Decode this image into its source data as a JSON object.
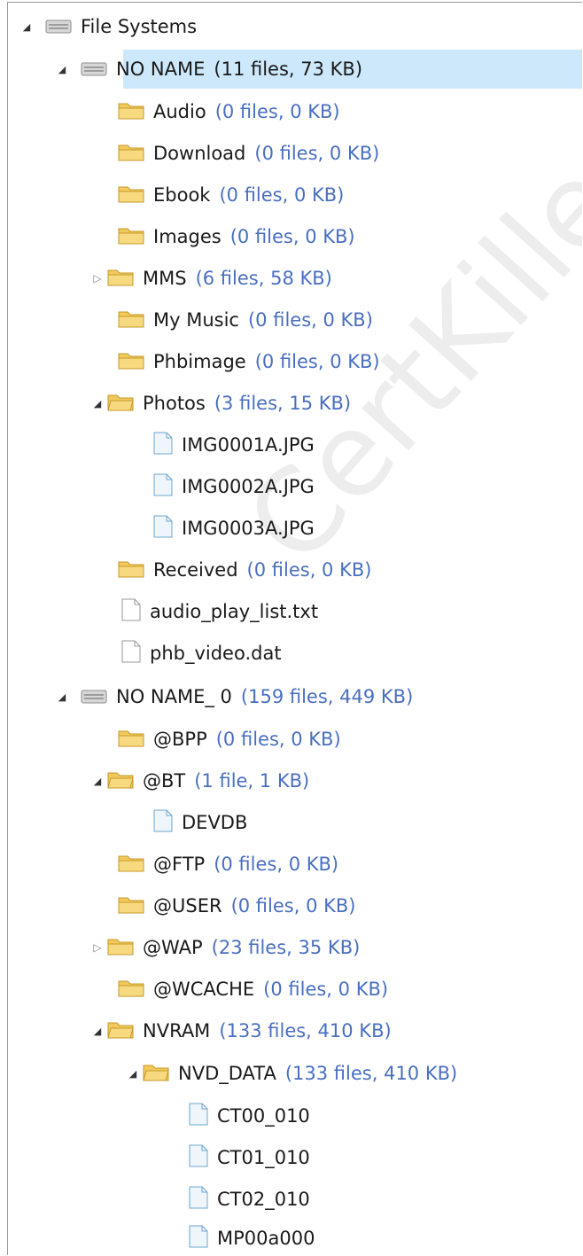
{
  "tree": {
    "root": {
      "label": "File Systems"
    },
    "volumes": [
      {
        "name": "NO NAME",
        "meta": "(11 files, 73 KB)",
        "children": [
          {
            "name": "Audio",
            "meta": "(0 files, 0 KB)"
          },
          {
            "name": "Download",
            "meta": "(0 files, 0 KB)"
          },
          {
            "name": "Ebook",
            "meta": "(0 files, 0 KB)"
          },
          {
            "name": "Images",
            "meta": "(0 files, 0 KB)"
          },
          {
            "name": "MMS",
            "meta": "(6 files, 58 KB)"
          },
          {
            "name": "My Music",
            "meta": "(0 files, 0 KB)"
          },
          {
            "name": "Phbimage",
            "meta": "(0 files, 0 KB)"
          },
          {
            "name": "Photos",
            "meta": "(3 files, 15 KB)",
            "files": [
              "IMG0001A.JPG",
              "IMG0002A.JPG",
              "IMG0003A.JPG"
            ]
          },
          {
            "name": "Received",
            "meta": "(0 files, 0 KB)"
          },
          {
            "name": "audio_play_list.txt"
          },
          {
            "name": "phb_video.dat"
          }
        ]
      },
      {
        "name": "NO NAME_ 0",
        "meta": "(159 files, 449 KB)",
        "children": [
          {
            "name": "@BPP",
            "meta": "(0 files, 0 KB)"
          },
          {
            "name": "@BT",
            "meta": "(1 file, 1 KB)",
            "files": [
              "DEVDB"
            ]
          },
          {
            "name": "@FTP",
            "meta": "(0 files, 0 KB)"
          },
          {
            "name": "@USER",
            "meta": "(0 files, 0 KB)"
          },
          {
            "name": "@WAP",
            "meta": "(23 files, 35 KB)"
          },
          {
            "name": "@WCACHE",
            "meta": "(0 files, 0 KB)"
          },
          {
            "name": "NVRAM",
            "meta": "(133 files, 410 KB)"
          },
          {
            "name": "NVD_DATA",
            "meta": "(133 files, 410 KB)",
            "files": [
              "CT00_010",
              "CT01_010",
              "CT02_010",
              "MP00a000"
            ]
          }
        ]
      }
    ]
  },
  "watermark": "CertKille",
  "colors": {
    "selection": "#cde8fb",
    "meta_text": "#4a6fc0",
    "folder": "#f2c95b"
  }
}
